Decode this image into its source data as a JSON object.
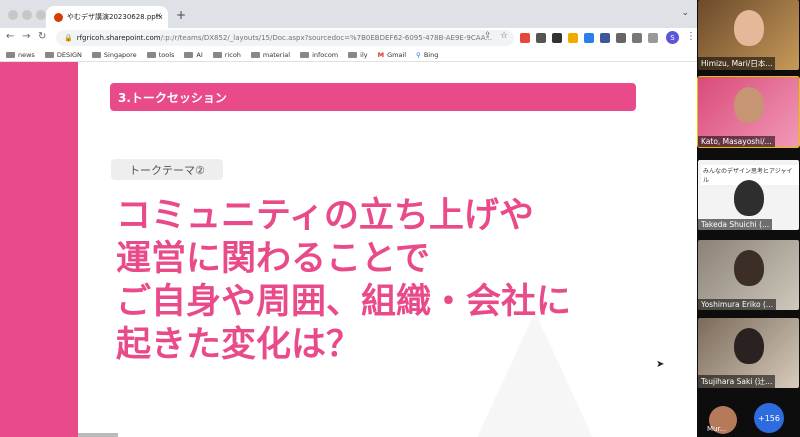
{
  "browser": {
    "tab_title": "やむデザ講演20230628.pptx",
    "tab_close": "×",
    "new_tab": "+",
    "tab_menu": "⌄",
    "nav": {
      "back": "←",
      "forward": "→",
      "reload": "↻"
    },
    "url": {
      "lock": "🔒",
      "host": "rfgricoh.sharepoint.com",
      "path": "/:p:/r/teams/DX852/_layouts/15/Doc.aspx?sourcedoc=%7B0EBDEF62-6095-478B-AE9E-9CAA..."
    },
    "omnibox_actions": {
      "share": "⇪",
      "star": "☆"
    },
    "profile_initial": "S",
    "menu": "⋮",
    "bookmarks": [
      {
        "label": "news",
        "type": "folder"
      },
      {
        "label": "DESIGN",
        "type": "folder"
      },
      {
        "label": "Singapore",
        "type": "folder"
      },
      {
        "label": "tools",
        "type": "folder"
      },
      {
        "label": "AI",
        "type": "folder"
      },
      {
        "label": "ricoh",
        "type": "folder"
      },
      {
        "label": "material",
        "type": "folder"
      },
      {
        "label": "infocom",
        "type": "folder"
      },
      {
        "label": "ily",
        "type": "folder"
      },
      {
        "label": "Gmail",
        "type": "gmail"
      },
      {
        "label": "Bing",
        "type": "bing"
      }
    ]
  },
  "slide": {
    "section_title": "3.トークセッション",
    "theme_tag": "トークテーマ②",
    "question_lines": [
      "コミュニティの立ち上げや",
      "運営に関わることで",
      "ご自身や周囲、組織・会社に",
      "起きた変化は？"
    ]
  },
  "participants": {
    "tiles": [
      {
        "name": "Himizu, Mari/日本...",
        "active": false
      },
      {
        "name": "Kato, Masayoshi/...",
        "active": true
      },
      {
        "name": "Takeda Shuichi (...",
        "active": false,
        "caption": "みんなのデザイン思考ヒアジャイル"
      },
      {
        "name": "Yoshimura Eriko (...",
        "active": false
      },
      {
        "name": "Tsujihara Saki (辻...",
        "active": false
      }
    ],
    "bottom_name": "Mur...",
    "more_count": "+156"
  },
  "colors": {
    "accent": "#e94a8a",
    "tabbar": "#dee1e6",
    "theme_tag_bg": "#eeeeee",
    "more_badge": "#2d6cdf"
  }
}
